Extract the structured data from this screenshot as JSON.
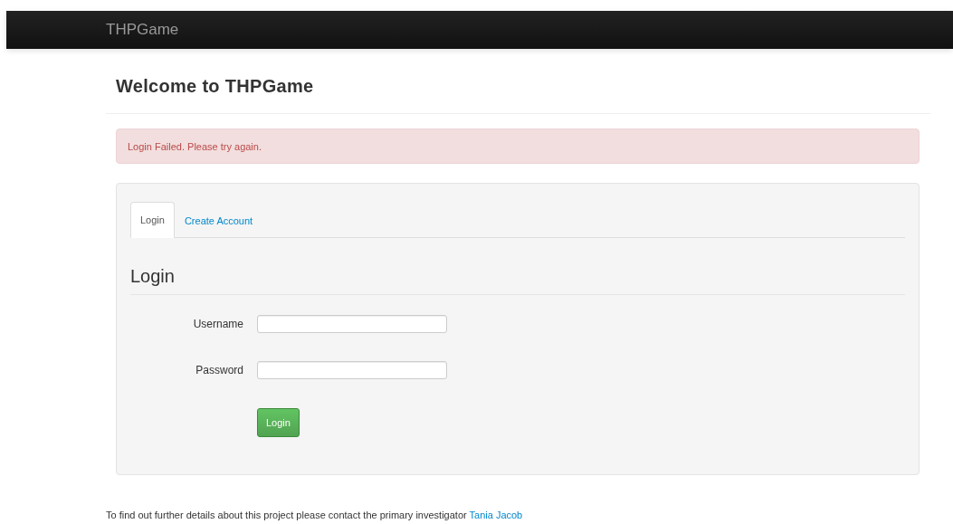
{
  "navbar": {
    "brand": "THPGame"
  },
  "page_title": "Welcome to THPGame",
  "alert": {
    "message": "Login Failed. Please try again."
  },
  "tabs": [
    {
      "label": "Login",
      "selected": true
    },
    {
      "label": "Create Account",
      "selected": false
    }
  ],
  "form": {
    "title": "Login",
    "fields": [
      {
        "label": "Username"
      },
      {
        "label": "Password"
      }
    ],
    "submit": "Login"
  },
  "footer": {
    "text": "To find out further details about this project please contact the primary investigator",
    "link": "Tania Jacob"
  }
}
